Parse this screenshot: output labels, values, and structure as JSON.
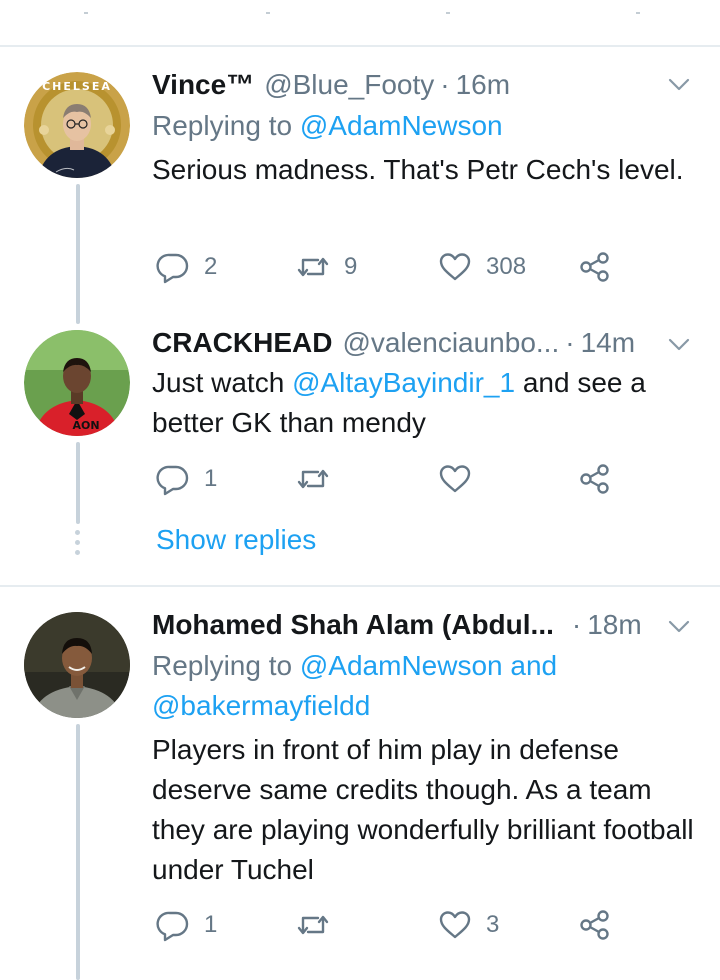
{
  "tweets": [
    {
      "name": "Vince™",
      "handle": "@Blue_Footy",
      "time": "16m",
      "reply_prefix": "Replying to",
      "reply_to": "@AdamNewson",
      "text": "Serious madness. That's Petr Cech's level.",
      "replies": "2",
      "retweets": "9",
      "likes": "308",
      "avatar_icon": "tuchel-chelsea-badge-avatar"
    },
    {
      "name": "CRACKHEAD",
      "handle": "@valenciaunbo...",
      "time": "14m",
      "text_mention": "@AltayBayindir_1",
      "text_before": "Just watch ",
      "text_after": " and see a better GK than mendy",
      "replies": "1",
      "retweets": "",
      "likes": "",
      "show_replies": "Show replies",
      "avatar_icon": "player-red-kit-avatar"
    },
    {
      "name": "Mohamed Shah Alam (Abdul...",
      "time": "18m",
      "reply_prefix": "Replying to",
      "reply_to": "@AdamNewson and",
      "reply_to_2": "@bakermayfieldd",
      "text": "Players in front of him play in defense deserve same credits though. As a team they are playing wonderfully brilliant football under Tuchel",
      "replies": "1",
      "retweets": "",
      "likes": "3",
      "avatar_icon": "man-portrait-avatar"
    }
  ],
  "colors": {
    "link": "#1da1f2",
    "secondary_text": "#657786",
    "divider": "#e6ecf0",
    "thread_line": "#c7d2db"
  }
}
